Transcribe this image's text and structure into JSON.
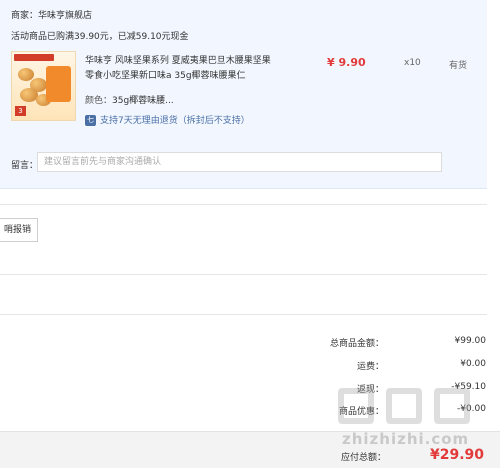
{
  "merchant": {
    "label": "商家：",
    "name": "华味亨旗舰店"
  },
  "promo": {
    "text": "活动商品已购满39.90元，已减59.10元现金"
  },
  "product": {
    "title": "华味亨 风味坚果系列 夏威夷果巴旦木腰果坚果零食小吃坚果新口味a 35g椰蓉味腰果仁",
    "spec_label": "颜色：",
    "spec_value": "35g椰蓉味腰...",
    "return_icon": "七",
    "return_text": "支持7天无理由退货（拆封后不支持）",
    "price": "¥ 9.90",
    "qty": "x10",
    "stock": "有货",
    "thumb_badge": "3"
  },
  "note": {
    "label": "留言：",
    "placeholder": "建议留言前先与商家沟通确认"
  },
  "invoice": {
    "label": "哨报销"
  },
  "summary": {
    "goods_total_label": "总商品金额：",
    "goods_total_value": "¥99.00",
    "shipping_label": "运费：",
    "shipping_value": "¥0.00",
    "rebate_label": "返现：",
    "rebate_value": "-¥59.10",
    "discount_label": "商品优惠：",
    "discount_value": "-¥0.00"
  },
  "total": {
    "label": "应付总额：",
    "value": "¥29.90"
  },
  "watermark": {
    "text": "zhizhizhi.com"
  },
  "colors": {
    "price_red": "#e23a3a",
    "panel_bg": "#f2f7ff",
    "link_blue": "#4a6fa5"
  },
  "icons": {
    "return": "seven-day-return-icon"
  }
}
